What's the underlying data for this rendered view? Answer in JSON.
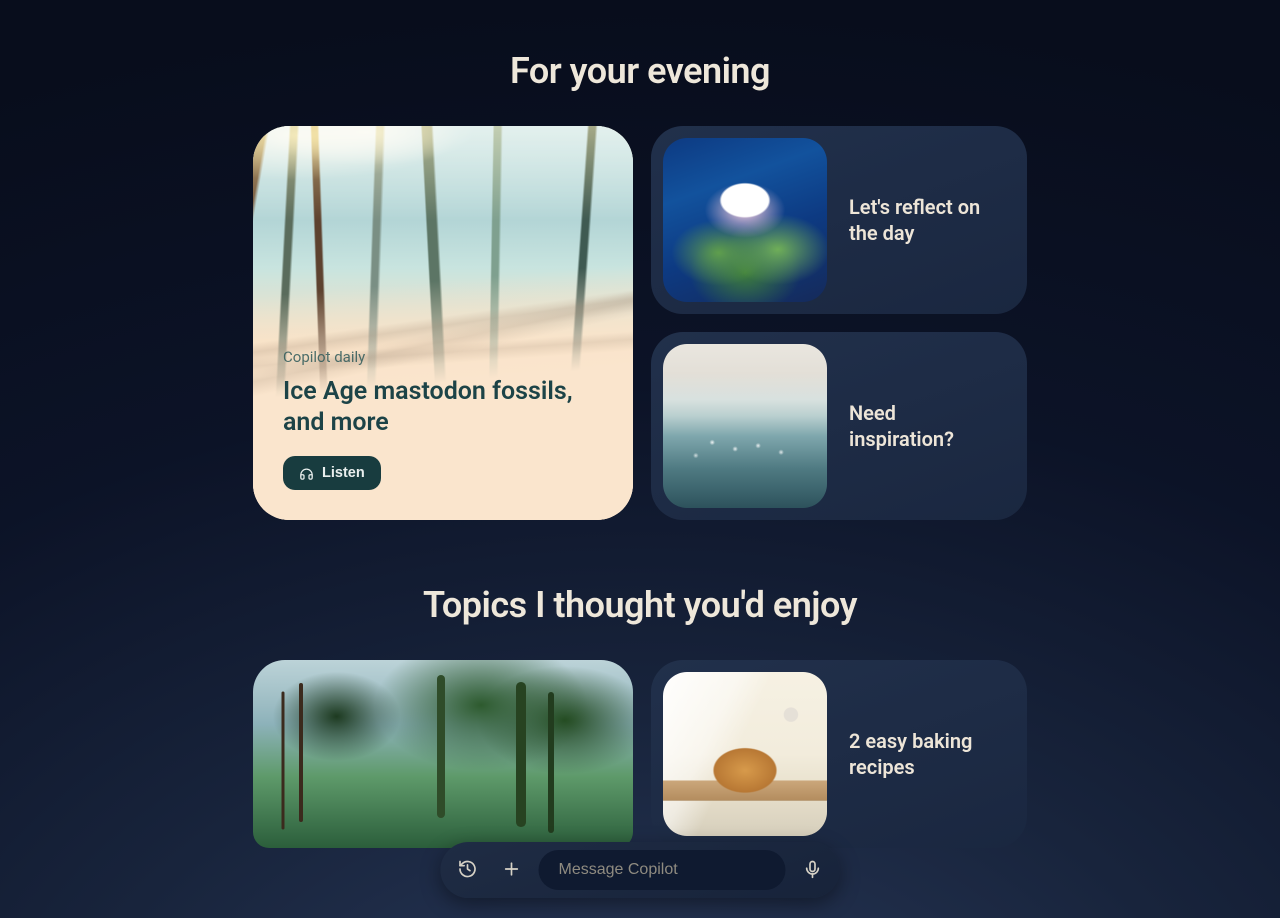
{
  "sections": {
    "evening": {
      "title": "For your evening",
      "feature": {
        "kicker": "Copilot daily",
        "headline": "Ice Age mastodon fossils, and more",
        "listen_label": "Listen"
      },
      "cards": [
        {
          "label": "Let's reflect on the day",
          "thumb": "lily"
        },
        {
          "label": "Need inspiration?",
          "thumb": "ocean"
        }
      ]
    },
    "topics": {
      "title": "Topics I thought you'd enjoy",
      "cards": [
        {
          "label": "2 easy baking recipes",
          "thumb": "bread"
        }
      ]
    }
  },
  "inputbar": {
    "placeholder": "Message Copilot"
  }
}
